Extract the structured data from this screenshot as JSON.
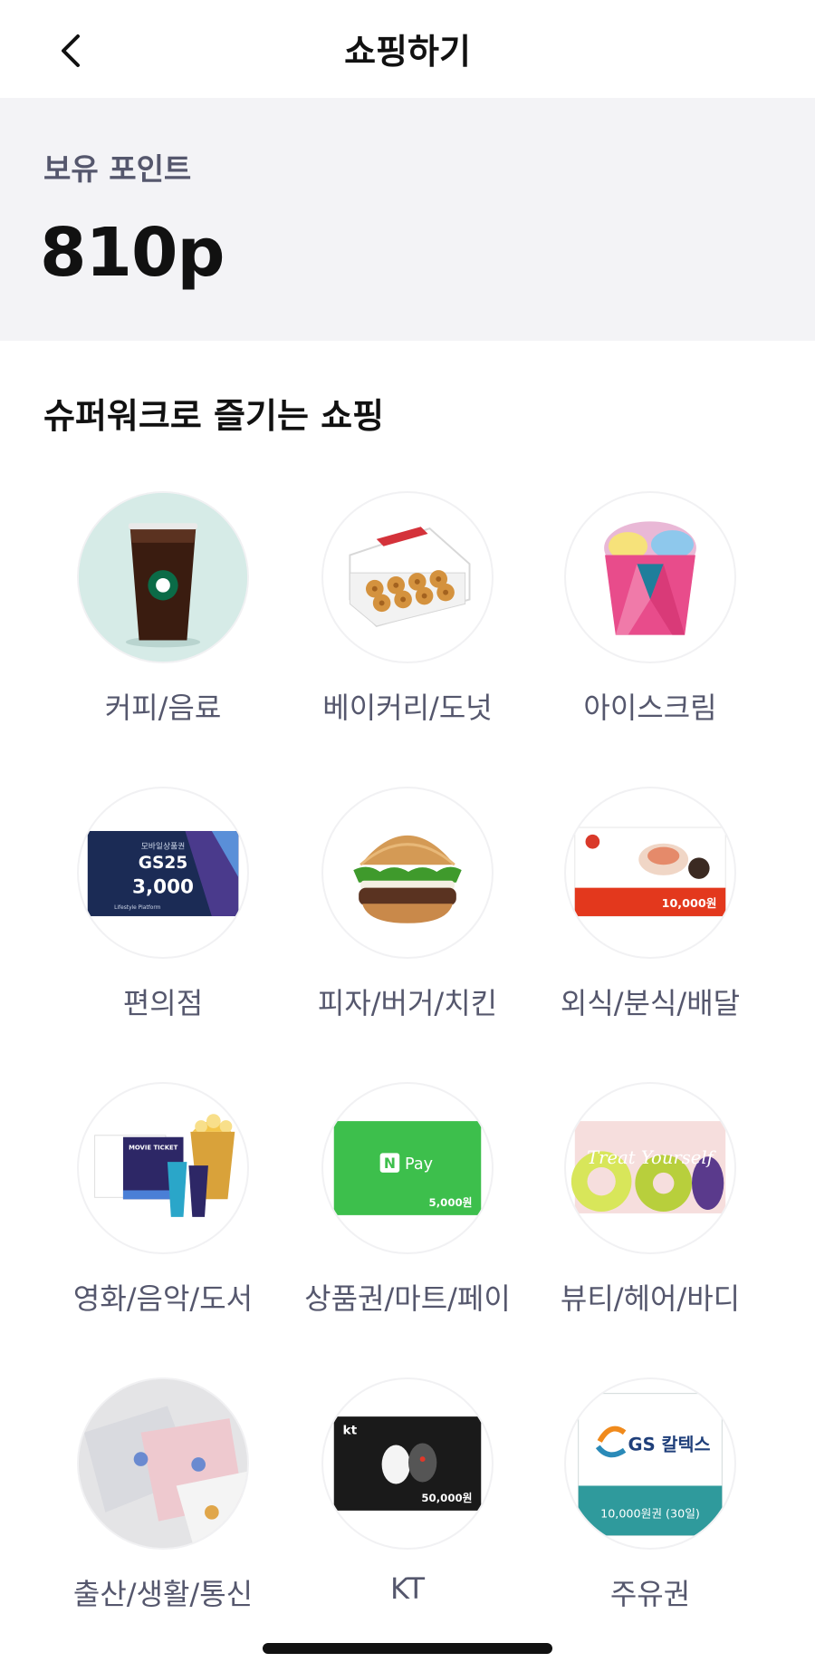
{
  "header": {
    "title": "쇼핑하기",
    "back_icon": "chevron-left-icon"
  },
  "points": {
    "label": "보유 포인트",
    "value": "810p"
  },
  "section": {
    "title": "슈퍼워크로 즐기는 쇼핑"
  },
  "categories": [
    {
      "label": "커피/음료",
      "icon": "coffee-icon"
    },
    {
      "label": "베이커리/도넛",
      "icon": "donut-box-icon"
    },
    {
      "label": "아이스크림",
      "icon": "ice-cream-icon"
    },
    {
      "label": "편의점",
      "icon": "gift-card-icon",
      "card_top": "모바일상품권",
      "card_brand": "GS25",
      "card_amount": "3,000",
      "card_footer": "Lifestyle Platform"
    },
    {
      "label": "피자/버거/치킨",
      "icon": "burger-icon"
    },
    {
      "label": "외식/분식/배달",
      "icon": "food-voucher-icon",
      "card_amount": "10,000원"
    },
    {
      "label": "영화/음악/도서",
      "icon": "movie-ticket-icon",
      "card_text": "MOVIE TICKET"
    },
    {
      "label": "상품권/마트/페이",
      "icon": "npay-card-icon",
      "card_text": "Pay",
      "card_amount": "5,000원"
    },
    {
      "label": "뷰티/헤어/바디",
      "icon": "beauty-card-icon",
      "card_text": "Treat Yourself"
    },
    {
      "label": "출산/생활/통신",
      "icon": "towel-icon"
    },
    {
      "label": "KT",
      "icon": "kt-card-icon",
      "card_amount": "50,000원"
    },
    {
      "label": "주유권",
      "icon": "gs-caltex-card-icon",
      "card_brand": "GS 칼텍스",
      "card_amount": "10,000원권 (30일)"
    }
  ],
  "colors": {
    "accent_text": "#55576d",
    "points_bg": "#f3f3f6",
    "coffee_bg": "#d6ebe7"
  }
}
